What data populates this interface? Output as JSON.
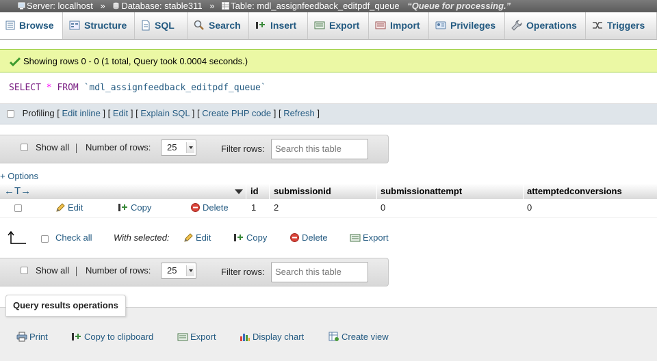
{
  "breadcrumb": {
    "server": "Server: localhost",
    "database": "Database: stable311",
    "table": "Table: mdl_assignfeedback_editpdf_queue",
    "comment": "“Queue for processing.”",
    "separator": "»"
  },
  "tabs": [
    {
      "label": "Browse",
      "icon": "browse-icon",
      "active": true
    },
    {
      "label": "Structure",
      "icon": "structure-icon"
    },
    {
      "label": "SQL",
      "icon": "sql-icon"
    },
    {
      "label": "Search",
      "icon": "search-icon"
    },
    {
      "label": "Insert",
      "icon": "insert-icon"
    },
    {
      "label": "Export",
      "icon": "export-icon"
    },
    {
      "label": "Import",
      "icon": "import-icon"
    },
    {
      "label": "Privileges",
      "icon": "privileges-icon"
    },
    {
      "label": "Operations",
      "icon": "wrench-icon"
    },
    {
      "label": "Triggers",
      "icon": "triggers-icon"
    }
  ],
  "success": {
    "message": "Showing rows 0 - 0 (1 total, Query took 0.0004 seconds.)",
    "icon": "checkmark-icon",
    "color": "#ebf8a4"
  },
  "sql": {
    "select": "SELECT",
    "star": "*",
    "from": "FROM",
    "table": "`mdl_assignfeedback_editpdf_queue`"
  },
  "profiling": {
    "label": "Profiling",
    "links": [
      "Edit inline",
      "Edit",
      "Explain SQL",
      "Create PHP code",
      "Refresh"
    ]
  },
  "nav": {
    "show_all": "Show all",
    "rows_label": "Number of rows:",
    "rows_value": "25",
    "filter_label": "Filter rows:",
    "filter_placeholder": "Search this table"
  },
  "options_link": "+ Options",
  "table": {
    "arrows": "←T→",
    "columns": [
      "id",
      "submissionid",
      "submissionattempt",
      "attemptedconversions"
    ],
    "rows": [
      {
        "edit": "Edit",
        "copy": "Copy",
        "delete": "Delete",
        "values": [
          "1",
          "2",
          "0",
          "0"
        ]
      }
    ]
  },
  "bulk": {
    "check_all": "Check all",
    "with_selected": "With selected:",
    "edit": "Edit",
    "copy": "Copy",
    "delete": "Delete",
    "export": "Export"
  },
  "query_ops": {
    "title": "Query results operations",
    "print": "Print",
    "copy_clipboard": "Copy to clipboard",
    "export": "Export",
    "display_chart": "Display chart",
    "create_view": "Create view"
  }
}
